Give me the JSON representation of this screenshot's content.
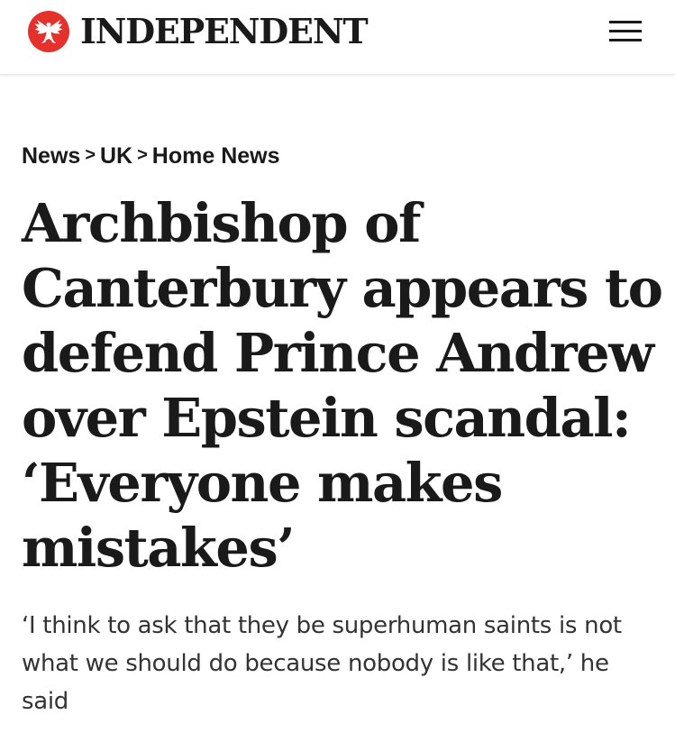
{
  "header": {
    "logo_text": "INDEPENDENT",
    "logo_icon": "eagle-icon",
    "menu_icon": "hamburger-menu-icon",
    "brand_color": "#e4312b"
  },
  "breadcrumb": {
    "items": [
      "News",
      "UK",
      "Home News"
    ],
    "separator": ">"
  },
  "article": {
    "headline_lines": [
      "Archbishop of",
      "Canterbury appears to",
      "defend Prince Andrew",
      "over Epstein scandal:",
      "‘Everyone makes",
      "mistakes’"
    ],
    "standfirst_lines": [
      "‘I think to ask that they be superhuman saints is not",
      "what we should do because nobody is like that,’ he",
      "said"
    ]
  }
}
